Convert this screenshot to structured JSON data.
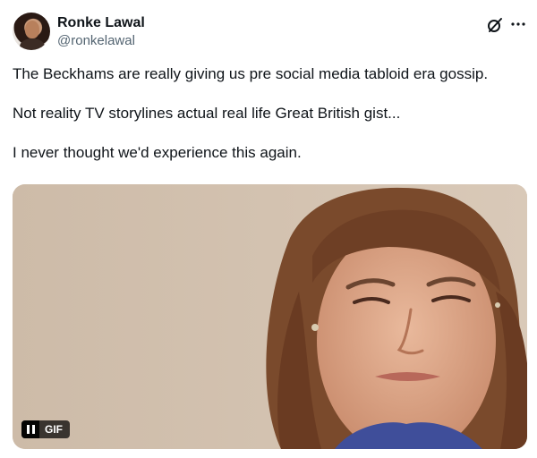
{
  "author": {
    "display_name": "Ronke Lawal",
    "handle": "@ronkelawal"
  },
  "header_icons": [
    "grok-icon",
    "more-icon"
  ],
  "tweet": {
    "paragraphs": [
      "The Beckhams are really giving us pre social media tabloid era gossip.",
      "Not reality TV storylines actual real life Great British gist...",
      "I never thought we'd experience this again."
    ]
  },
  "media": {
    "type": "gif",
    "badge_label": "GIF",
    "controls": [
      "pause-icon"
    ]
  },
  "colors": {
    "text": "#0f1419",
    "secondary_text": "#536471",
    "media_background": "#d6c6b3",
    "badge_background": "#000000"
  }
}
